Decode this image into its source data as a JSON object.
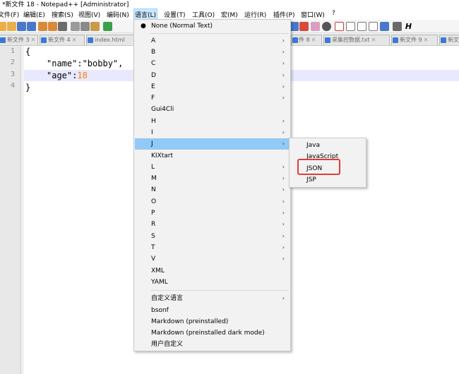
{
  "window": {
    "title": "*新文件 18 - Notepad++ [Administrator]"
  },
  "menubar": {
    "items": [
      {
        "label": "文件(F)"
      },
      {
        "label": "编辑(E)"
      },
      {
        "label": "搜索(S)"
      },
      {
        "label": "视图(V)"
      },
      {
        "label": "编码(N)"
      },
      {
        "label": "语言(L)"
      },
      {
        "label": "设置(T)"
      },
      {
        "label": "工具(O)"
      },
      {
        "label": "宏(M)"
      },
      {
        "label": "运行(R)"
      },
      {
        "label": "插件(P)"
      },
      {
        "label": "窗口(W)"
      },
      {
        "label": "?"
      }
    ]
  },
  "tabs": [
    {
      "label": "新文件 3",
      "close": "✕"
    },
    {
      "label": "新文件 4",
      "close": "✕"
    },
    {
      "label": "index.html",
      "close": ""
    },
    {
      "label": "文件 8",
      "close": "✕"
    },
    {
      "label": "采集控数据.txt",
      "close": "✕"
    },
    {
      "label": "新文件 9",
      "close": "✕"
    },
    {
      "label": "新文",
      "close": ""
    }
  ],
  "editor": {
    "line_numbers": [
      "1",
      "2",
      "3",
      "4"
    ],
    "lines": {
      "l1": "{",
      "l2": "\"name\":\"bobby\",",
      "l3_key": "\"age\":",
      "l3_val": "18",
      "l4": "}"
    }
  },
  "language_menu": {
    "checked_item": "None (Normal Text)",
    "checked_mark": "●",
    "arrow": "›",
    "items": [
      {
        "label": "A"
      },
      {
        "label": "B"
      },
      {
        "label": "C"
      },
      {
        "label": "D"
      },
      {
        "label": "E"
      },
      {
        "label": "F"
      },
      {
        "label": "Gui4Cli"
      },
      {
        "label": "H"
      },
      {
        "label": "I"
      },
      {
        "label": "J"
      },
      {
        "label": "KIXtart"
      },
      {
        "label": "L"
      },
      {
        "label": "M"
      },
      {
        "label": "N"
      },
      {
        "label": "O"
      },
      {
        "label": "P"
      },
      {
        "label": "R"
      },
      {
        "label": "S"
      },
      {
        "label": "T"
      },
      {
        "label": "V"
      },
      {
        "label": "XML"
      },
      {
        "label": "YAML"
      }
    ],
    "user_items": [
      {
        "label": "自定义语言"
      },
      {
        "label": "bsonf"
      },
      {
        "label": "Markdown (preinstalled)"
      },
      {
        "label": "Markdown (preinstalled dark mode)"
      },
      {
        "label": "用户自定义"
      }
    ]
  },
  "j_submenu": {
    "items": [
      {
        "label": "Java"
      },
      {
        "label": "JavaScript"
      },
      {
        "label": "JSON"
      },
      {
        "label": "JSP"
      }
    ]
  },
  "colors": {
    "highlight": "#91c9f7",
    "annotation_box": "#e03b3b",
    "current_line": "#e8e8ff"
  }
}
